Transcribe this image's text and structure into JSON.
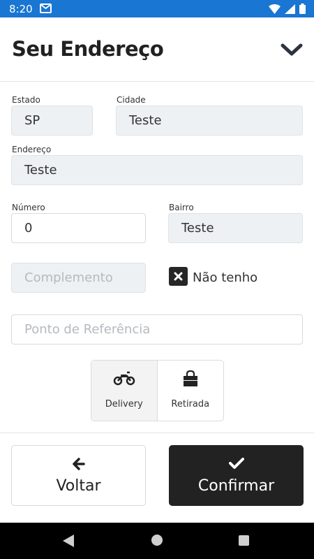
{
  "status_bar": {
    "time": "8:20",
    "icons": [
      "mail-icon",
      "wifi-icon",
      "signal-icon",
      "battery-icon"
    ]
  },
  "header": {
    "title": "Seu Endereço",
    "toggle_icon": "chevron-down-icon"
  },
  "form": {
    "estado": {
      "label": "Estado",
      "value": "SP"
    },
    "cidade": {
      "label": "Cidade",
      "value": "Teste"
    },
    "endereco": {
      "label": "Endereço",
      "value": "Teste"
    },
    "numero": {
      "label": "Número",
      "value": "0"
    },
    "bairro": {
      "label": "Bairro",
      "value": "Teste"
    },
    "complemento": {
      "placeholder": "Complemento"
    },
    "nao_tenho": {
      "label": "Não tenho",
      "checked": true
    },
    "referencia": {
      "placeholder": "Ponto de Referência"
    }
  },
  "delivery_mode": {
    "selected": "Delivery",
    "options": [
      {
        "label": "Delivery",
        "icon": "motorcycle-icon"
      },
      {
        "label": "Retirada",
        "icon": "shopping-bag-icon"
      }
    ]
  },
  "actions": {
    "back_label": "Voltar",
    "back_icon": "arrow-left-icon",
    "confirm_label": "Confirmar",
    "confirm_icon": "check-icon"
  },
  "colors": {
    "status_bar": "#1976d2",
    "confirm_button": "#222222",
    "field_fill": "#eef1f3"
  }
}
